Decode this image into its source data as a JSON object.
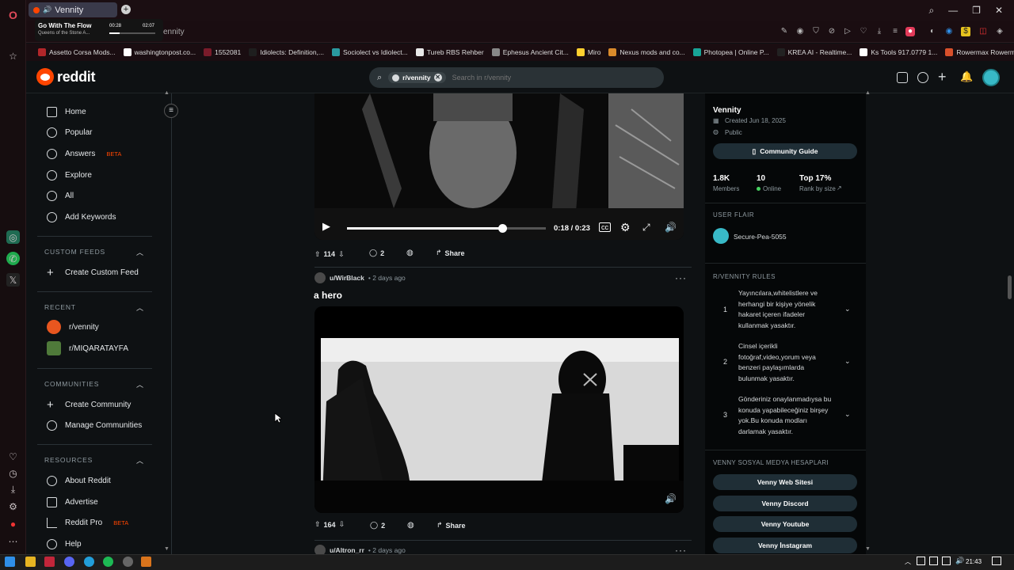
{
  "browser": {
    "tab_title": "Vennity",
    "url_fragment": "ennity",
    "media": {
      "title": "Go With The Flow",
      "artist": "Queens of the Stone A...",
      "elapsed": "00:28",
      "duration": "02:07",
      "progress": 0.23
    },
    "bookmarks": [
      {
        "label": "Assetto Corsa Mods...",
        "color": "#b3262a"
      },
      {
        "label": "washingtonpost.co...",
        "color": "#ffffff"
      },
      {
        "label": "1552081",
        "color": "#7a1b2a"
      },
      {
        "label": "Idiolects: Definition,...",
        "color": "#1e1e1e"
      },
      {
        "label": "Sociolect vs Idiolect...",
        "color": "#2a9aa0"
      },
      {
        "label": "Tureb RBS Rehber",
        "color": "#e8e8e8"
      },
      {
        "label": "Ephesus Ancient Cit...",
        "color": "#888888"
      },
      {
        "label": "Miro",
        "color": "#ffd02f"
      },
      {
        "label": "Nexus mods and co...",
        "color": "#d98a2b"
      },
      {
        "label": "Photopea | Online P...",
        "color": "#18a497"
      },
      {
        "label": "KREA AI - Realtime...",
        "color": "#222222"
      },
      {
        "label": "Ks Tools 917.0779 1...",
        "color": "#ffffff"
      },
      {
        "label": "Rowermax Rowerm...",
        "color": "#d9502b"
      }
    ]
  },
  "reddit": {
    "logo_text": "reddit",
    "search": {
      "chip": "r/vennity",
      "placeholder": "Search in r/vennity"
    }
  },
  "leftnav": {
    "items": [
      "Home",
      "Popular",
      "Answers",
      "Explore",
      "All",
      "Add Keywords"
    ],
    "answers_badge": "BETA",
    "custom_feeds": {
      "header": "CUSTOM FEEDS",
      "create": "Create Custom Feed"
    },
    "recent": {
      "header": "RECENT",
      "items": [
        "r/vennity",
        "r/MIQARATAYFA"
      ]
    },
    "communities": {
      "header": "COMMUNITIES",
      "items": [
        "Create Community",
        "Manage Communities"
      ]
    },
    "resources": {
      "header": "RESOURCES",
      "items": [
        "About Reddit",
        "Advertise",
        "Reddit Pro",
        "Help"
      ],
      "pro_badge": "BETA"
    }
  },
  "feed": {
    "post1": {
      "video_time": "0:18 / 0:23",
      "video_progress": 0.78,
      "votes": "114",
      "comments": "2",
      "share": "Share"
    },
    "post2": {
      "author": "u/WirBlack",
      "time": "• 2 days ago",
      "title": "a hero",
      "votes": "164",
      "comments": "2",
      "share": "Share"
    },
    "post3": {
      "author": "u/Altron_rr",
      "time": "• 2 days ago"
    }
  },
  "sidebar": {
    "community": "Vennity",
    "created": "Created Jun 18, 2025",
    "visibility": "Public",
    "guide_button": "Community Guide",
    "stats": [
      {
        "value": "1.8K",
        "label": "Members"
      },
      {
        "value": "10",
        "label": "Online"
      },
      {
        "value": "Top 17%",
        "label": "Rank by size"
      }
    ],
    "user_flair_header": "USER FLAIR",
    "user_flair_name": "Secure-Pea-5055",
    "rules_header": "R/VENNITY RULES",
    "rules": [
      {
        "n": "1",
        "text": "Yayıncılara,whitelistlere ve herhangi bir kişiye yönelik hakaret içeren ifadeler kullanmak yasaktır."
      },
      {
        "n": "2",
        "text": "Cinsel içerikli fotoğraf,video,yorum veya benzeri paylaşımlarda bulunmak yasaktır."
      },
      {
        "n": "3",
        "text": "Gönderiniz onaylanmadıysa bu konuda yapabileceğiniz birşey yok.Bu konuda modları darlamak yasaktır."
      }
    ],
    "social_header": "VENNY SOSYAL MEDYA HESAPLARI",
    "social_links": [
      "Venny Web Sitesi",
      "Venny Discord",
      "Venny Youtube",
      "Venny İnstagram"
    ]
  },
  "taskbar": {
    "clock": "21:43"
  },
  "colors": {
    "reddit_orange": "#ff4500",
    "online_green": "#46d160",
    "button_bg": "#1f2e36"
  }
}
